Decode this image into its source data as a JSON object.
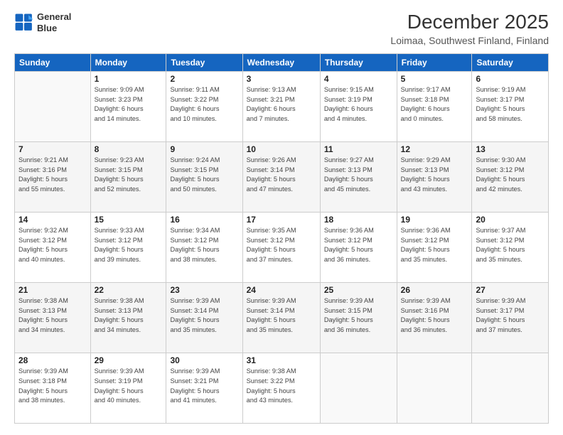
{
  "logo": {
    "line1": "General",
    "line2": "Blue"
  },
  "header": {
    "title": "December 2025",
    "subtitle": "Loimaa, Southwest Finland, Finland"
  },
  "weekdays": [
    "Sunday",
    "Monday",
    "Tuesday",
    "Wednesday",
    "Thursday",
    "Friday",
    "Saturday"
  ],
  "weeks": [
    [
      {
        "day": "",
        "info": ""
      },
      {
        "day": "1",
        "info": "Sunrise: 9:09 AM\nSunset: 3:23 PM\nDaylight: 6 hours\nand 14 minutes."
      },
      {
        "day": "2",
        "info": "Sunrise: 9:11 AM\nSunset: 3:22 PM\nDaylight: 6 hours\nand 10 minutes."
      },
      {
        "day": "3",
        "info": "Sunrise: 9:13 AM\nSunset: 3:21 PM\nDaylight: 6 hours\nand 7 minutes."
      },
      {
        "day": "4",
        "info": "Sunrise: 9:15 AM\nSunset: 3:19 PM\nDaylight: 6 hours\nand 4 minutes."
      },
      {
        "day": "5",
        "info": "Sunrise: 9:17 AM\nSunset: 3:18 PM\nDaylight: 6 hours\nand 0 minutes."
      },
      {
        "day": "6",
        "info": "Sunrise: 9:19 AM\nSunset: 3:17 PM\nDaylight: 5 hours\nand 58 minutes."
      }
    ],
    [
      {
        "day": "7",
        "info": "Sunrise: 9:21 AM\nSunset: 3:16 PM\nDaylight: 5 hours\nand 55 minutes."
      },
      {
        "day": "8",
        "info": "Sunrise: 9:23 AM\nSunset: 3:15 PM\nDaylight: 5 hours\nand 52 minutes."
      },
      {
        "day": "9",
        "info": "Sunrise: 9:24 AM\nSunset: 3:15 PM\nDaylight: 5 hours\nand 50 minutes."
      },
      {
        "day": "10",
        "info": "Sunrise: 9:26 AM\nSunset: 3:14 PM\nDaylight: 5 hours\nand 47 minutes."
      },
      {
        "day": "11",
        "info": "Sunrise: 9:27 AM\nSunset: 3:13 PM\nDaylight: 5 hours\nand 45 minutes."
      },
      {
        "day": "12",
        "info": "Sunrise: 9:29 AM\nSunset: 3:13 PM\nDaylight: 5 hours\nand 43 minutes."
      },
      {
        "day": "13",
        "info": "Sunrise: 9:30 AM\nSunset: 3:12 PM\nDaylight: 5 hours\nand 42 minutes."
      }
    ],
    [
      {
        "day": "14",
        "info": "Sunrise: 9:32 AM\nSunset: 3:12 PM\nDaylight: 5 hours\nand 40 minutes."
      },
      {
        "day": "15",
        "info": "Sunrise: 9:33 AM\nSunset: 3:12 PM\nDaylight: 5 hours\nand 39 minutes."
      },
      {
        "day": "16",
        "info": "Sunrise: 9:34 AM\nSunset: 3:12 PM\nDaylight: 5 hours\nand 38 minutes."
      },
      {
        "day": "17",
        "info": "Sunrise: 9:35 AM\nSunset: 3:12 PM\nDaylight: 5 hours\nand 37 minutes."
      },
      {
        "day": "18",
        "info": "Sunrise: 9:36 AM\nSunset: 3:12 PM\nDaylight: 5 hours\nand 36 minutes."
      },
      {
        "day": "19",
        "info": "Sunrise: 9:36 AM\nSunset: 3:12 PM\nDaylight: 5 hours\nand 35 minutes."
      },
      {
        "day": "20",
        "info": "Sunrise: 9:37 AM\nSunset: 3:12 PM\nDaylight: 5 hours\nand 35 minutes."
      }
    ],
    [
      {
        "day": "21",
        "info": "Sunrise: 9:38 AM\nSunset: 3:13 PM\nDaylight: 5 hours\nand 34 minutes."
      },
      {
        "day": "22",
        "info": "Sunrise: 9:38 AM\nSunset: 3:13 PM\nDaylight: 5 hours\nand 34 minutes."
      },
      {
        "day": "23",
        "info": "Sunrise: 9:39 AM\nSunset: 3:14 PM\nDaylight: 5 hours\nand 35 minutes."
      },
      {
        "day": "24",
        "info": "Sunrise: 9:39 AM\nSunset: 3:14 PM\nDaylight: 5 hours\nand 35 minutes."
      },
      {
        "day": "25",
        "info": "Sunrise: 9:39 AM\nSunset: 3:15 PM\nDaylight: 5 hours\nand 36 minutes."
      },
      {
        "day": "26",
        "info": "Sunrise: 9:39 AM\nSunset: 3:16 PM\nDaylight: 5 hours\nand 36 minutes."
      },
      {
        "day": "27",
        "info": "Sunrise: 9:39 AM\nSunset: 3:17 PM\nDaylight: 5 hours\nand 37 minutes."
      }
    ],
    [
      {
        "day": "28",
        "info": "Sunrise: 9:39 AM\nSunset: 3:18 PM\nDaylight: 5 hours\nand 38 minutes."
      },
      {
        "day": "29",
        "info": "Sunrise: 9:39 AM\nSunset: 3:19 PM\nDaylight: 5 hours\nand 40 minutes."
      },
      {
        "day": "30",
        "info": "Sunrise: 9:39 AM\nSunset: 3:21 PM\nDaylight: 5 hours\nand 41 minutes."
      },
      {
        "day": "31",
        "info": "Sunrise: 9:38 AM\nSunset: 3:22 PM\nDaylight: 5 hours\nand 43 minutes."
      },
      {
        "day": "",
        "info": ""
      },
      {
        "day": "",
        "info": ""
      },
      {
        "day": "",
        "info": ""
      }
    ]
  ]
}
